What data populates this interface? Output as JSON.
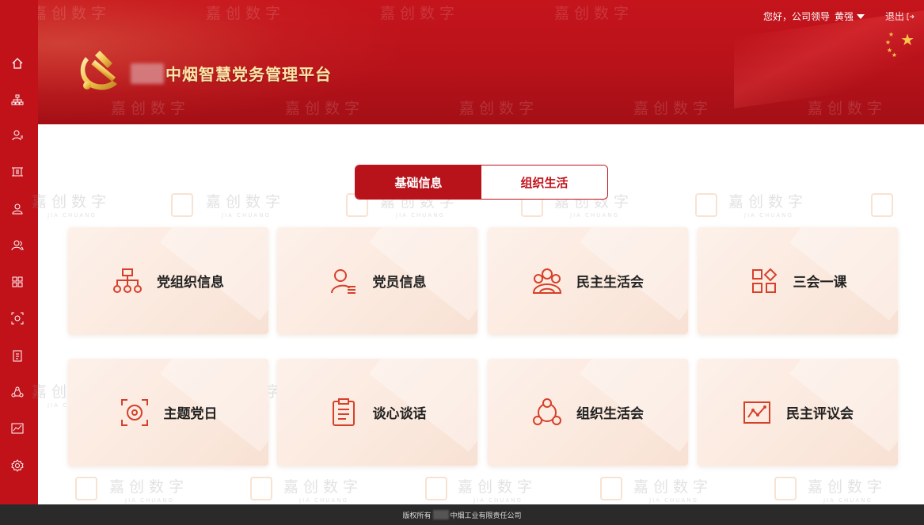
{
  "header": {
    "platform_title": "中烟智慧党务管理平台",
    "greeting": "您好，公司领导",
    "user_name": "黄强",
    "logout_label": "退出"
  },
  "sidebar": {
    "items": [
      {
        "icon": "home-icon"
      },
      {
        "icon": "org-structure-icon"
      },
      {
        "icon": "member-icon"
      },
      {
        "icon": "scan-icon"
      },
      {
        "icon": "user-icon"
      },
      {
        "icon": "user-group-icon"
      },
      {
        "icon": "grid-icon"
      },
      {
        "icon": "target-icon"
      },
      {
        "icon": "clipboard-icon"
      },
      {
        "icon": "recycle-icon"
      },
      {
        "icon": "chart-icon"
      },
      {
        "icon": "settings-icon"
      }
    ]
  },
  "tabs": [
    {
      "label": "基础信息",
      "active": true
    },
    {
      "label": "组织生活",
      "active": false
    }
  ],
  "cards": [
    {
      "label": "党组织信息",
      "icon": "org-chart-icon"
    },
    {
      "label": "党员信息",
      "icon": "member-info-icon"
    },
    {
      "label": "民主生活会",
      "icon": "people-group-icon"
    },
    {
      "label": "三会一课",
      "icon": "apps-grid-icon"
    },
    {
      "label": "主题党日",
      "icon": "focus-target-icon"
    },
    {
      "label": "谈心谈话",
      "icon": "document-list-icon"
    },
    {
      "label": "组织生活会",
      "icon": "network-circle-icon"
    },
    {
      "label": "民主评议会",
      "icon": "trend-chart-icon"
    }
  ],
  "watermark": {
    "text": "嘉创数字",
    "sub": "JIA CHUANG"
  },
  "footer": {
    "prefix": "版权所有",
    "suffix": "中烟工业有限责任公司"
  },
  "colors": {
    "brand_red": "#c1121a",
    "title_gold": "#fde6a9",
    "icon_red": "#d6402a"
  }
}
